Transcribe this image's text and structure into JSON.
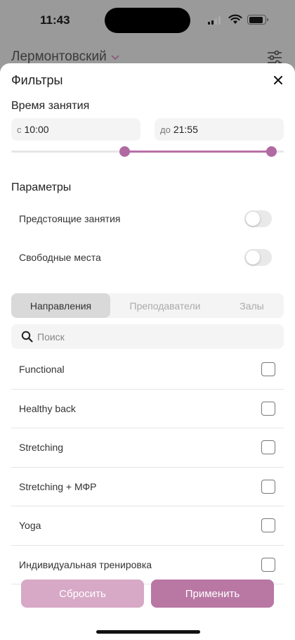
{
  "status_bar": {
    "time": "11:43"
  },
  "background": {
    "location": "Лермонтовский",
    "location_chevron": "chevron-down-icon",
    "filter_icon": "sliders-icon"
  },
  "sheet": {
    "title": "Фильтры",
    "close_icon": "close-icon",
    "time_section": {
      "title": "Время занятия",
      "from_prefix": "с",
      "from_value": "10:00",
      "to_prefix": "до",
      "to_value": "21:55",
      "slider_start_fraction": 0.415,
      "slider_end_fraction": 0.955
    },
    "params_section": {
      "title": "Параметры",
      "toggles": [
        {
          "label": "Предстоящие занятия",
          "on": false
        },
        {
          "label": "Свободные места",
          "on": false
        }
      ]
    },
    "segments": [
      {
        "label": "Направления",
        "active": true
      },
      {
        "label": "Преподаватели",
        "active": false
      },
      {
        "label": "Залы",
        "active": false
      }
    ],
    "search": {
      "placeholder": "Поиск",
      "icon": "search-icon"
    },
    "list": [
      {
        "label": "Functional",
        "checked": false
      },
      {
        "label": "Healthy back",
        "checked": false
      },
      {
        "label": "Stretching",
        "checked": false
      },
      {
        "label": "Stretching + МФР",
        "checked": false
      },
      {
        "label": "Yoga",
        "checked": false
      },
      {
        "label": "Индивидуальная тренировка",
        "checked": false
      }
    ],
    "buttons": {
      "reset": "Сбросить",
      "apply": "Применить"
    }
  },
  "colors": {
    "accent": "#b06aa1",
    "apply": "#b977a4",
    "reset": "#d7a9c6"
  }
}
